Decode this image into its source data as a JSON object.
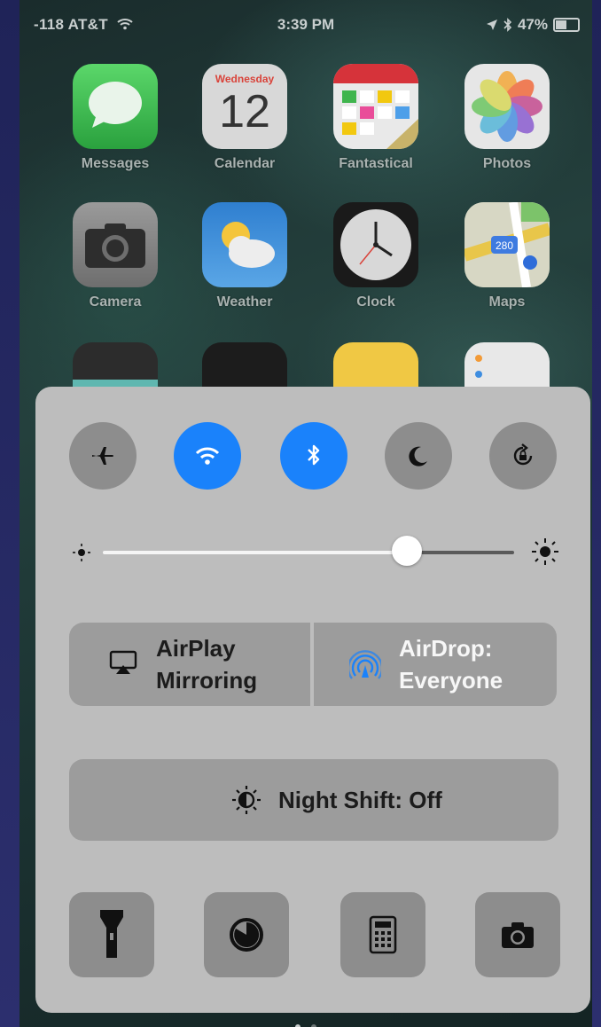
{
  "status_bar": {
    "signal": "-118 AT&T",
    "time": "3:39 PM",
    "battery": "47%"
  },
  "apps": [
    {
      "label": "Messages",
      "icon": "messages-icon"
    },
    {
      "label": "Calendar",
      "icon": "calendar-icon",
      "weekday": "Wednesday",
      "day": "12"
    },
    {
      "label": "Fantastical",
      "icon": "fantastical-icon"
    },
    {
      "label": "Photos",
      "icon": "photos-icon"
    },
    {
      "label": "Camera",
      "icon": "camera-icon"
    },
    {
      "label": "Weather",
      "icon": "weather-icon"
    },
    {
      "label": "Clock",
      "icon": "clock-icon"
    },
    {
      "label": "Maps",
      "icon": "maps-icon",
      "route": "280"
    }
  ],
  "control_center": {
    "toggles": [
      {
        "name": "airplane-mode",
        "icon": "airplane-icon",
        "on": false
      },
      {
        "name": "wifi",
        "icon": "wifi-icon",
        "on": true
      },
      {
        "name": "bluetooth",
        "icon": "bluetooth-icon",
        "on": true
      },
      {
        "name": "do-not-disturb",
        "icon": "moon-icon",
        "on": false
      },
      {
        "name": "rotation-lock",
        "icon": "rotation-lock-icon",
        "on": false
      }
    ],
    "brightness": 0.74,
    "airplay": {
      "line1": "AirPlay",
      "line2": "Mirroring"
    },
    "airdrop": {
      "line1": "AirDrop:",
      "line2": "Everyone"
    },
    "night_shift": "Night Shift: Off",
    "shortcuts": [
      {
        "name": "flashlight",
        "icon": "flashlight-icon"
      },
      {
        "name": "timer",
        "icon": "timer-icon"
      },
      {
        "name": "calculator",
        "icon": "calculator-icon"
      },
      {
        "name": "camera",
        "icon": "camera-icon"
      }
    ]
  },
  "page_dots": {
    "count": 2,
    "current": 1
  },
  "colors": {
    "accent_blue": "#1a82fb",
    "panel": "#bdbdbd",
    "button_gray": "#8d8d8d",
    "wide_button": "#9c9c9c"
  }
}
